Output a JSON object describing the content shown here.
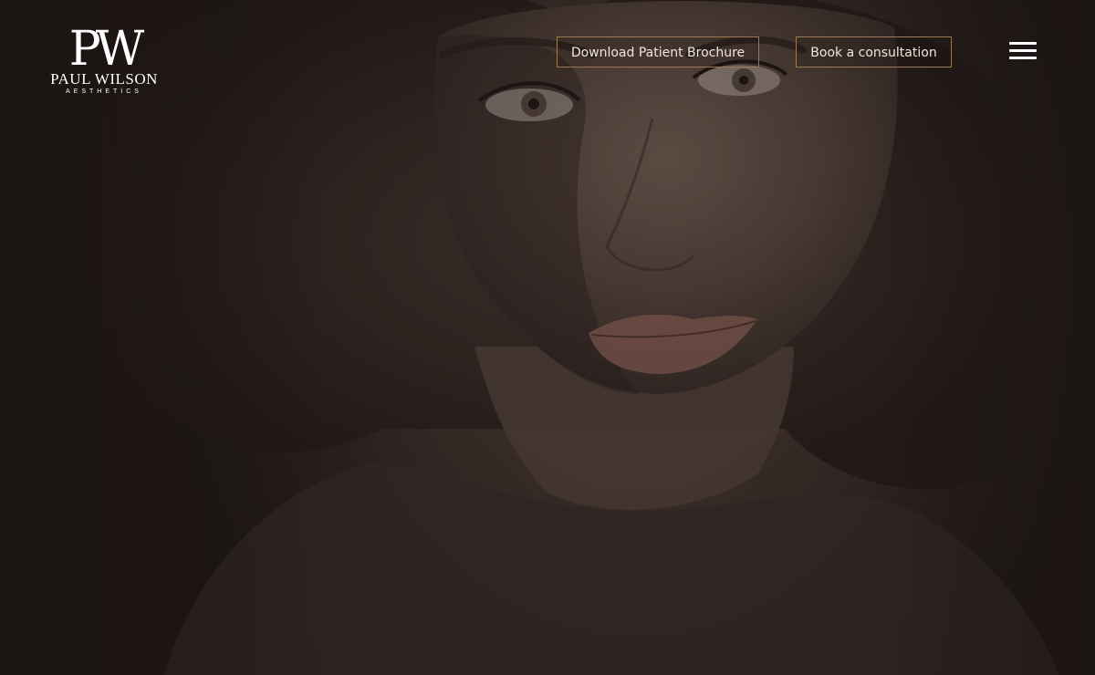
{
  "brand": {
    "monogram": "PW",
    "name": "PAUL WILSON",
    "tagline": "AESTHETICS"
  },
  "header": {
    "brochure_label": "Download Patient Brochure",
    "consult_label": "Book a consultation",
    "menu_icon": "hamburger-menu-icon"
  },
  "colors": {
    "button_border": "#9b7b4f",
    "button_text": "#f1e6d8",
    "background_dark": "#2a2120"
  },
  "hero": {
    "image_subject": "portrait-photo"
  }
}
